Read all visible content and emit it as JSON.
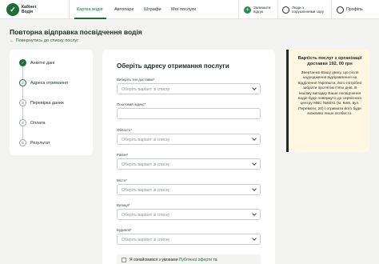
{
  "header": {
    "logo_mark": "✓",
    "logo_line1": "Кабінет",
    "logo_line2": "Водія",
    "nav": [
      {
        "label": "Картка водія",
        "active": true
      },
      {
        "label": "Автопарк",
        "active": false
      },
      {
        "label": "Штрафи",
        "active": false
      },
      {
        "label": "Мої послуги",
        "active": false
      }
    ],
    "report": {
      "line1": "Залишити",
      "line2": "відгук",
      "icon": "plus-icon"
    },
    "accessibility": {
      "line1": "Люди з",
      "line2": "порушеннями зору",
      "icon": "eye-icon"
    },
    "profile": {
      "label": "Профіль",
      "icon": "user-icon"
    }
  },
  "page": {
    "title": "Повторна відправка посвідчення водія",
    "back_arrow": "←",
    "back_label": "Повернутись до списку послуг"
  },
  "steps": [
    {
      "number": "✓",
      "label": "Анкетні дані",
      "state": "done"
    },
    {
      "number": "2",
      "label": "Адреса отримання",
      "state": "current"
    },
    {
      "number": "3",
      "label": "Перевірка даних",
      "state": "todo"
    },
    {
      "number": "4",
      "label": "Оплата",
      "state": "todo"
    },
    {
      "number": "5",
      "label": "Результат",
      "state": "todo"
    }
  ],
  "form": {
    "title": "Оберіть адресу отримання послуги",
    "fields": [
      {
        "label": "Виберіть тип доставки*",
        "placeholder": "Оберіть варіант зі списку",
        "type": "select"
      },
      {
        "label": "Поштовий індекс*",
        "placeholder": "",
        "type": "input"
      },
      {
        "label": "Область*",
        "placeholder": "Оберіть варіант зі списку",
        "type": "select"
      },
      {
        "label": "Район*",
        "placeholder": "Оберіть варіант зі списку",
        "type": "select"
      },
      {
        "label": "Місто*",
        "placeholder": "Оберіть варіант зі списку",
        "type": "select"
      },
      {
        "label": "Вулиця*",
        "placeholder": "Оберіть варіант зі списку",
        "type": "select"
      },
      {
        "label": "Будинок*",
        "placeholder": "Оберіть варіант зі списку",
        "type": "select"
      }
    ],
    "agree_prefix": "Я ознайомився з умовами ",
    "agree_link": "Публічної оферти",
    "agree_suffix": " та"
  },
  "info": {
    "title": "Вартість послуг з організації доставки 192, 00 грн",
    "body": "Звертаємо Вашу увагу, що після надходження відправлення на відділення Укрпошти, його потрібно забрати протягом п'яти днів. В іншому випадку Ваше посвідчення водія буде повернуто до сервісного центру МВС №8041 (м. Київ, вул. Перемоги, 20) і отримати його буде можливо лише особисто."
  }
}
